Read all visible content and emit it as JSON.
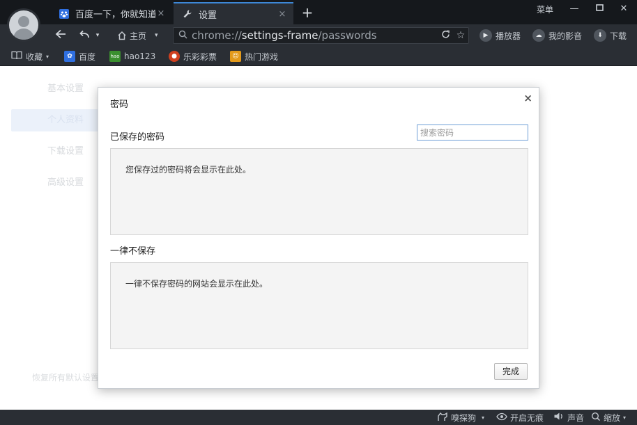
{
  "browser": {
    "tabs": [
      {
        "label": "百度一下，你就知道",
        "icon": "baidu-paw-icon"
      },
      {
        "label": "设置",
        "icon": "wrench-icon"
      }
    ],
    "menu_label": "菜单",
    "home_label": "主页",
    "address": {
      "scheme": "chrome://",
      "host": "settings-frame",
      "path": "/passwords"
    },
    "right_tools": [
      {
        "label": "播放器",
        "icon": "play-icon"
      },
      {
        "label": "我的影音",
        "icon": "cloud-icon"
      },
      {
        "label": "下载",
        "icon": "download-icon"
      }
    ],
    "bookmarks": [
      {
        "label": "收藏",
        "icon": "book-icon"
      },
      {
        "label": "百度",
        "icon": "baidu-paw-icon"
      },
      {
        "label": "hao123",
        "icon": "hao123-icon"
      },
      {
        "label": "乐彩彩票",
        "icon": "lottery-icon"
      },
      {
        "label": "热门游戏",
        "icon": "game-icon"
      }
    ]
  },
  "settings_page": {
    "sidebar": [
      {
        "label": "基本设置",
        "active": false
      },
      {
        "label": "个人资料",
        "active": true
      },
      {
        "label": "下载设置",
        "active": false
      },
      {
        "label": "高级设置",
        "active": false
      }
    ],
    "restore_label": "恢复所有默认设置"
  },
  "dialog": {
    "title": "密码",
    "close_glyph": "×",
    "saved_title": "已保存的密码",
    "search_placeholder": "搜索密码",
    "saved_empty": "您保存过的密码将会显示在此处。",
    "never_title": "一律不保存",
    "never_empty": "一律不保存密码的网站会显示在此处。",
    "done_label": "完成"
  },
  "statusbar": [
    {
      "label": "嗅探狗",
      "icon": "dog-icon"
    },
    {
      "label": "开启无痕",
      "icon": "eye-icon"
    },
    {
      "label": "声音",
      "icon": "speaker-icon"
    },
    {
      "label": "缩放",
      "icon": "zoom-icon"
    }
  ],
  "colors": {
    "accent": "#3d88d8",
    "chrome_dark": "#2a2e34",
    "titlebar": "#15181c"
  }
}
